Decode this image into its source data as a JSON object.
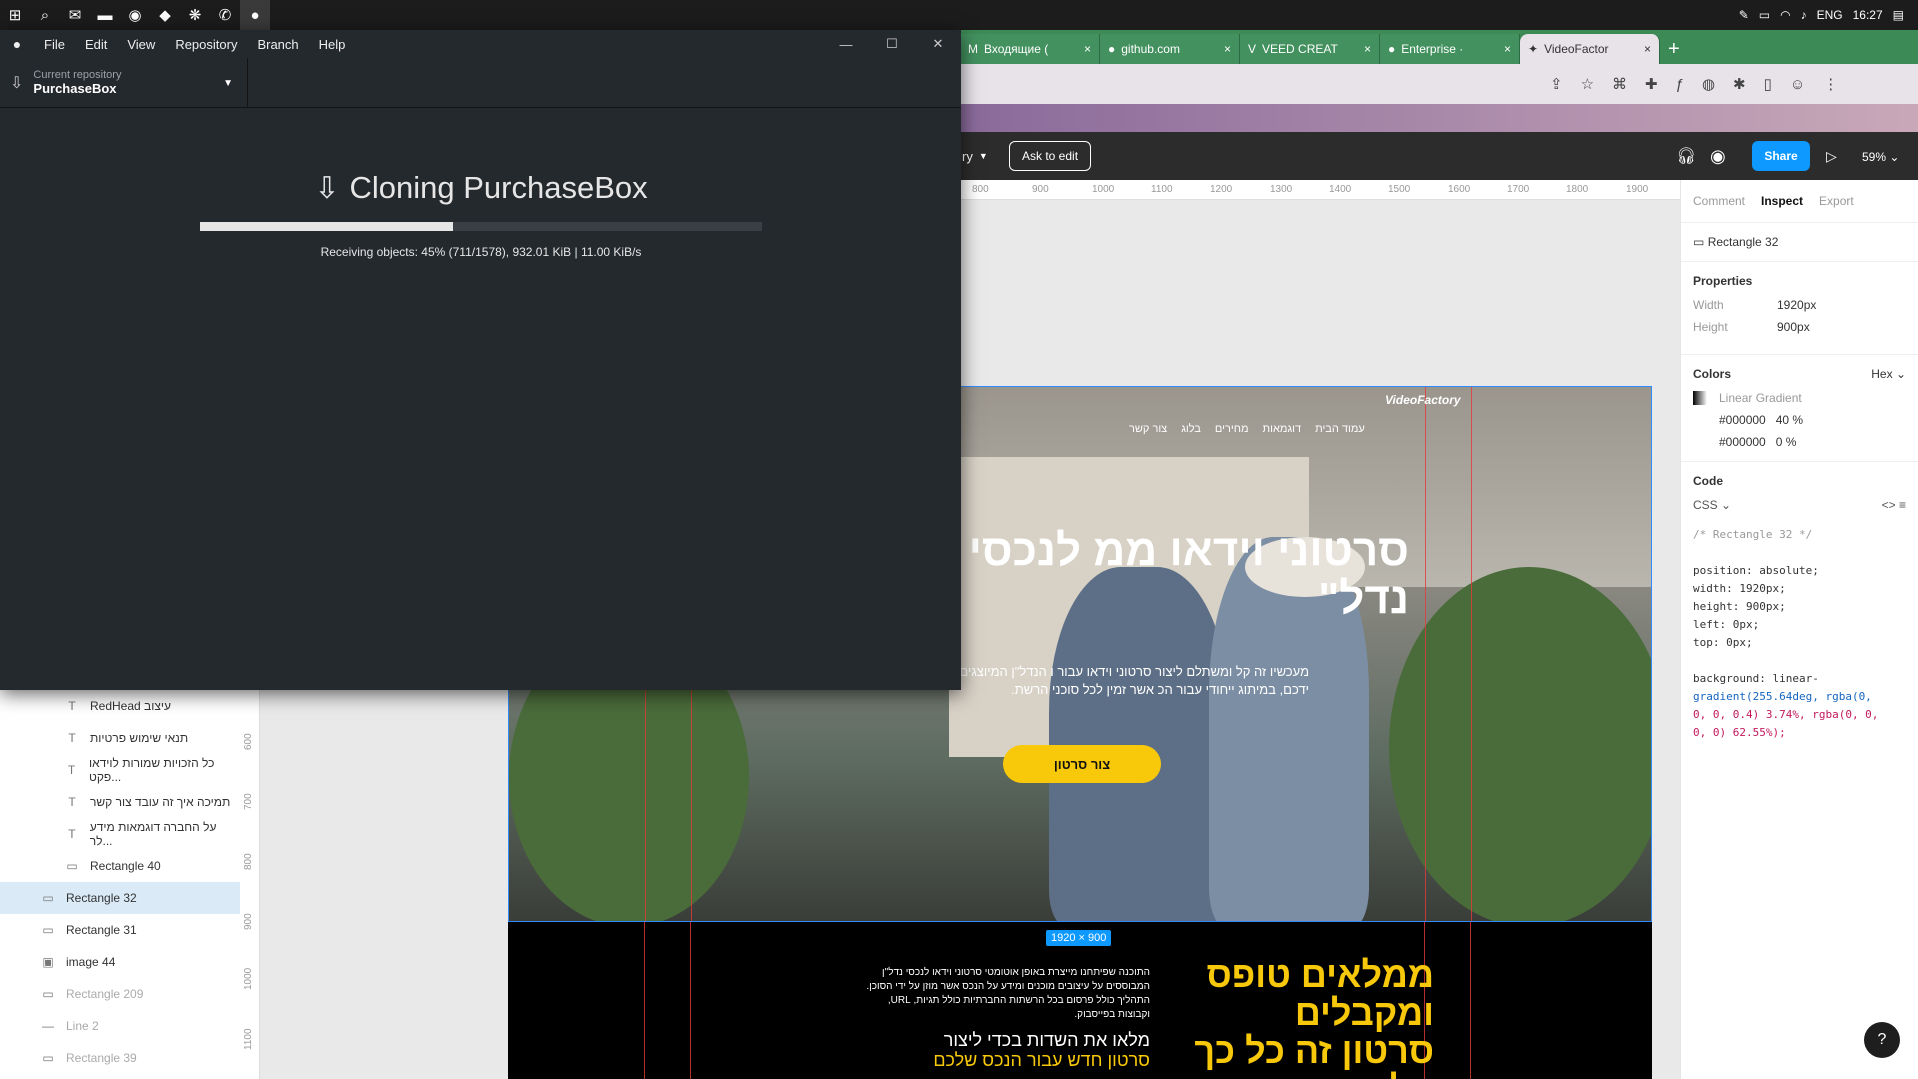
{
  "taskbar": {
    "icons": [
      "windows-start-icon",
      "search-icon",
      "mail-icon",
      "file-explorer-icon",
      "chrome-icon",
      "vscode-icon",
      "app-icon",
      "whatsapp-icon",
      "github-desktop-icon"
    ],
    "lang": "ENG",
    "time": "16:27"
  },
  "github_desktop": {
    "menu": [
      "File",
      "Edit",
      "View",
      "Repository",
      "Branch",
      "Help"
    ],
    "current_repo_label": "Current repository",
    "current_repo": "PurchaseBox",
    "clone_title": "Cloning PurchaseBox",
    "progress": 0.45,
    "status": "Receiving objects: 45% (711/1578), 932.01 KiB | 11.00 KiB/s"
  },
  "chrome": {
    "tabs": [
      {
        "label": "Входящие (",
        "active": false
      },
      {
        "label": "github.com",
        "active": false
      },
      {
        "label": "VEED CREAT",
        "active": false
      },
      {
        "label": "Enterprise ·",
        "active": false
      },
      {
        "label": "VideoFactor",
        "active": true
      }
    ]
  },
  "figma": {
    "ask_edit": "Ask to edit",
    "share": "Share",
    "zoom": "59%",
    "file_caret": "ry",
    "ruler_top": [
      "800",
      "900",
      "1000",
      "1100",
      "1200",
      "1300",
      "1400",
      "1500",
      "1600",
      "1700",
      "1800",
      "1900"
    ],
    "ruler_left": [
      "600",
      "700",
      "800",
      "900",
      "1000",
      "1100"
    ],
    "layers": [
      {
        "label": "RedHead עיצוב",
        "icon": "T",
        "indent": true,
        "sel": false,
        "dim": false
      },
      {
        "label": "תנאי שימוש פרטיות",
        "icon": "T",
        "indent": true,
        "sel": false,
        "dim": false
      },
      {
        "label": "כל הזכויות שמורות לוידאו פקט...",
        "icon": "T",
        "indent": true,
        "sel": false,
        "dim": false
      },
      {
        "label": "תמיכה איך זה עובד צור קשר",
        "icon": "T",
        "indent": true,
        "sel": false,
        "dim": false
      },
      {
        "label": "על החברה דוגמאות מידע לר...",
        "icon": "T",
        "indent": true,
        "sel": false,
        "dim": false
      },
      {
        "label": "Rectangle 40",
        "icon": "▭",
        "indent": true,
        "sel": false,
        "dim": false
      },
      {
        "label": "Rectangle 32",
        "icon": "▭",
        "indent": false,
        "sel": true,
        "dim": false
      },
      {
        "label": "Rectangle 31",
        "icon": "▭",
        "indent": false,
        "sel": false,
        "dim": false
      },
      {
        "label": "image 44",
        "icon": "▣",
        "indent": false,
        "sel": false,
        "dim": false
      },
      {
        "label": "Rectangle 209",
        "icon": "▭",
        "indent": false,
        "sel": false,
        "dim": true
      },
      {
        "label": "Line 2",
        "icon": "—",
        "indent": false,
        "sel": false,
        "dim": true
      },
      {
        "label": "Rectangle 39",
        "icon": "▭",
        "indent": false,
        "sel": false,
        "dim": true
      }
    ],
    "site": {
      "logo": "VideoFactory",
      "nav": [
        "עמוד הבית",
        "דוגמאות",
        "מחירים",
        "בלוג",
        "צור קשר"
      ],
      "hero_title": "סרטוני וידאו ממ לנכסי נדל\"",
      "hero_sub": "מעכשיו זה קל ומשתלם ליצור סרטוני וידאו עבור ו הנדל\"ן המיוצגים על ידכם, במיתוג ייחודי עבור הכ אשר זמין לכל סוכני הרשת.",
      "hero_btn": "צור סרטון",
      "s2_title": "ממלאים טופס ומקבלים סרטון זה כל כך קל",
      "s2_body": "התוכנה שפיתחנו מייצרת באופן אוטומטי סרטוני וידאו לנכסי נדל\"ן המבוססים על עיצובים מוכנים ומידע על הנכס אשר מוזן על ידי הסוכן. התהליך כולל פרסום בכל הרשתות החברתיות כולל תגיות, URL, וקבוצות בפייסבוק.",
      "s2_h": "מלאו את השדות בכדי ליצור",
      "s2_h2": "סרטון חדש עבור הנכס שלכם"
    },
    "size_badge": "1920 × 900",
    "inspect": {
      "tabs": [
        "Comment",
        "Inspect",
        "Export"
      ],
      "name": "Rectangle 32",
      "properties_h": "Properties",
      "width_k": "Width",
      "width_v": "1920px",
      "height_k": "Height",
      "height_v": "900px",
      "colors_h": "Colors",
      "color_mode": "Hex",
      "gradient_label": "Linear Gradient",
      "stop1": "#000000",
      "stop1_pct": "40 %",
      "stop2": "#000000",
      "stop2_pct": "0 %",
      "code_h": "Code",
      "code_lang": "CSS",
      "code_lines": [
        "/* Rectangle 32 */",
        "",
        "position: absolute;",
        "width: 1920px;",
        "height: 900px;",
        "left: 0px;",
        "top: 0px;",
        "",
        "background: linear-",
        "  gradient(255.64deg, rgba(0,",
        "  0, 0, 0.4) 3.74%, rgba(0, 0,",
        "  0, 0) 62.55%);"
      ]
    }
  }
}
